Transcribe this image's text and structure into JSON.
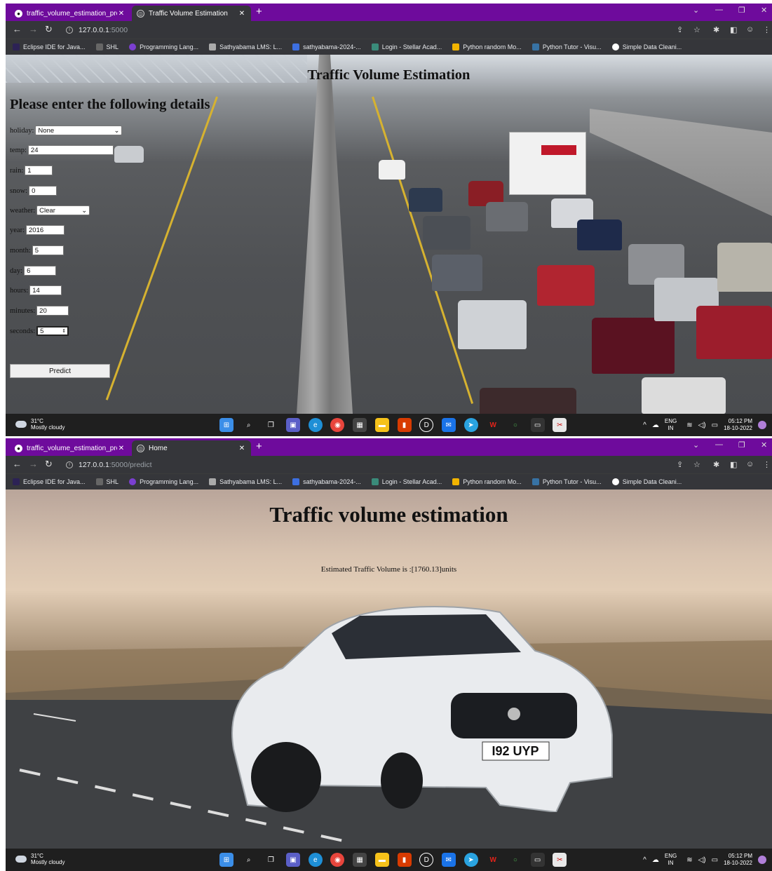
{
  "window1": {
    "tabs": [
      {
        "label": "traffic_volume_estimation_projec",
        "icon": "github-icon"
      },
      {
        "label": "Traffic Volume Estimation",
        "icon": "globe-icon"
      }
    ],
    "url_host": "127.0.0.1",
    "url_path": ":5000",
    "page": {
      "title": "Traffic Volume Estimation",
      "heading": "Please enter the following details",
      "fields": {
        "holiday": {
          "label": "holiday:",
          "value": "None"
        },
        "temp": {
          "label": "temp:",
          "value": "24"
        },
        "rain": {
          "label": "rain:",
          "value": "1"
        },
        "snow": {
          "label": "snow:",
          "value": "0"
        },
        "weather": {
          "label": "weather:",
          "value": "Clear"
        },
        "year": {
          "label": "year:",
          "value": "2016"
        },
        "month": {
          "label": "month:",
          "value": "5"
        },
        "day": {
          "label": "day:",
          "value": "6"
        },
        "hours": {
          "label": "hours:",
          "value": "14"
        },
        "minutes": {
          "label": "minutes:",
          "value": "20"
        },
        "seconds": {
          "label": "seconds:",
          "value": "5"
        }
      },
      "predict_label": "Predict"
    }
  },
  "window2": {
    "tabs": [
      {
        "label": "traffic_volume_estimation_projec",
        "icon": "github-icon"
      },
      {
        "label": "Home",
        "icon": "globe-icon"
      }
    ],
    "url_host": "127.0.0.1",
    "url_path": ":5000/predict",
    "page": {
      "title": "Traffic volume estimation",
      "result": "Estimated Traffic Volume is :[1760.13]units",
      "plate": "I92 UYP"
    }
  },
  "bookmarks": [
    "Eclipse IDE for Java...",
    "SHL",
    "Programming Lang...",
    "Sathyabama LMS: L...",
    "sathyabama-2024-...",
    "Login - Stellar Acad...",
    "Python random Mo...",
    "Python Tutor - Visu...",
    "Simple Data Cleani..."
  ],
  "taskbar": {
    "temperature": "31°C",
    "condition": "Mostly cloudy",
    "lang_top": "ENG",
    "lang_bottom": "IN",
    "time": "05:12 PM",
    "date": "18-10-2022"
  },
  "colors": {
    "tabbar": "#6e0b9c",
    "toolbar": "#35363a",
    "taskbar": "#1f1f1f"
  }
}
